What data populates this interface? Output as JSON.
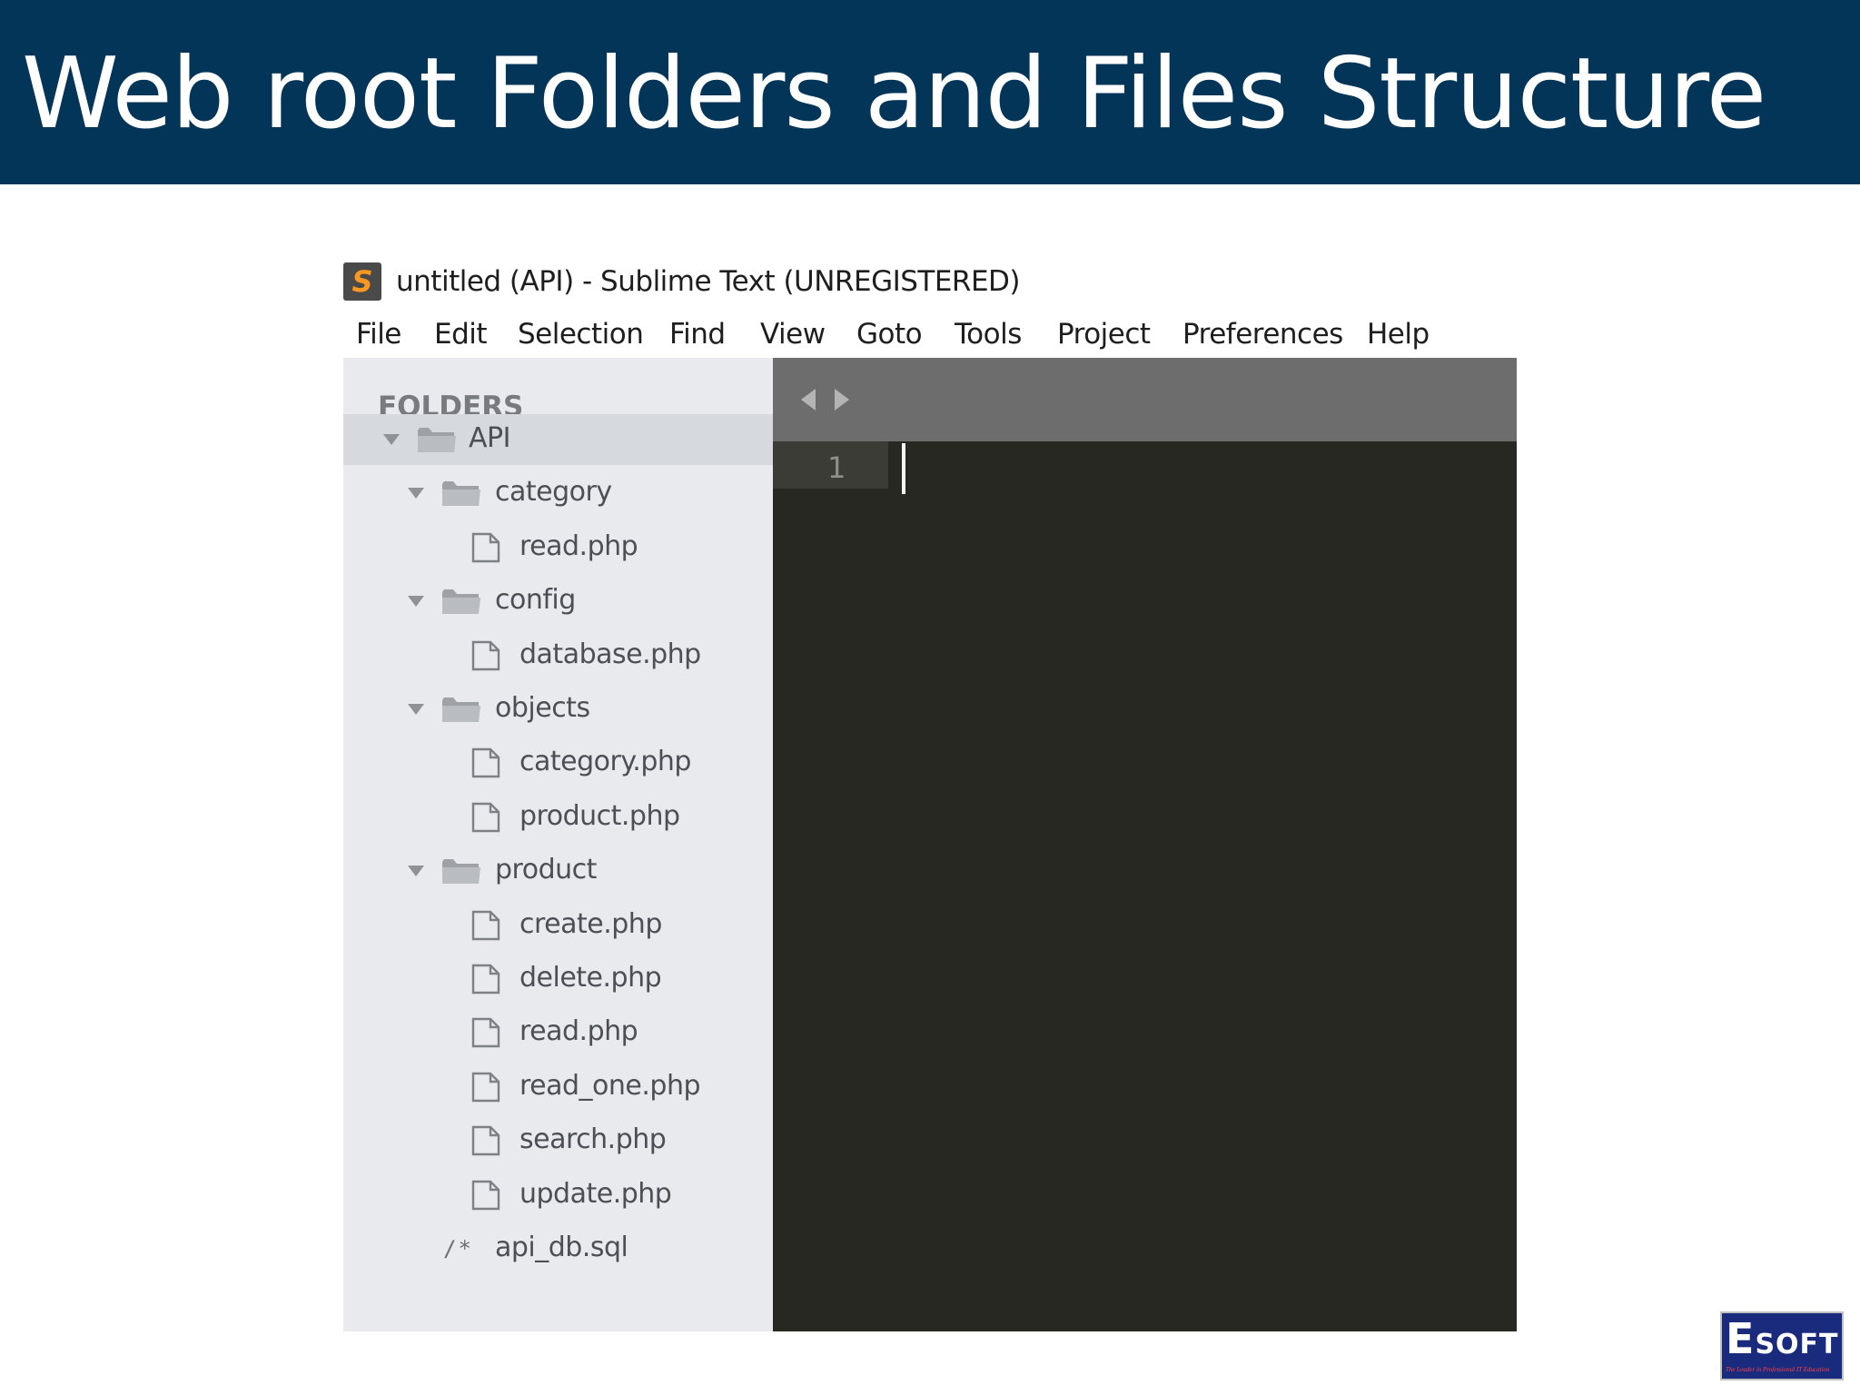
{
  "slide": {
    "title": "Web root Folders and Files Structure"
  },
  "window": {
    "app_icon_glyph": "S",
    "title": "untitled (API) - Sublime Text (UNREGISTERED)"
  },
  "menu": [
    "File",
    "Edit",
    "Selection",
    "Find",
    "View",
    "Goto",
    "Tools",
    "Project",
    "Preferences",
    "Help"
  ],
  "sidebar": {
    "heading": "FOLDERS",
    "tree": [
      {
        "type": "folder",
        "label": "API",
        "depth": 0,
        "expanded": true,
        "selected": true
      },
      {
        "type": "folder",
        "label": "category",
        "depth": 1,
        "expanded": true
      },
      {
        "type": "file",
        "label": "read.php",
        "depth": 2
      },
      {
        "type": "folder",
        "label": "config",
        "depth": 1,
        "expanded": true
      },
      {
        "type": "file",
        "label": "database.php",
        "depth": 2
      },
      {
        "type": "folder",
        "label": "objects",
        "depth": 1,
        "expanded": true
      },
      {
        "type": "file",
        "label": "category.php",
        "depth": 2
      },
      {
        "type": "file",
        "label": "product.php",
        "depth": 2
      },
      {
        "type": "folder",
        "label": "product",
        "depth": 1,
        "expanded": true
      },
      {
        "type": "file",
        "label": "create.php",
        "depth": 2
      },
      {
        "type": "file",
        "label": "delete.php",
        "depth": 2
      },
      {
        "type": "file",
        "label": "read.php",
        "depth": 2
      },
      {
        "type": "file",
        "label": "read_one.php",
        "depth": 2
      },
      {
        "type": "file",
        "label": "search.php",
        "depth": 2
      },
      {
        "type": "file",
        "label": "update.php",
        "depth": 2
      },
      {
        "type": "sql",
        "label": "api_db.sql",
        "depth": 1,
        "icon_text": "/*"
      }
    ]
  },
  "editor": {
    "line_number": "1",
    "theme_colors": {
      "background": "#272822",
      "tabbar": "#6d6d6d",
      "gutter_active": "#3b3c35"
    }
  },
  "logo": {
    "word_big": "E",
    "word_small": "SOFT",
    "tagline": "The Leader in Professional IT Education"
  },
  "colors": {
    "header_bg": "#023558",
    "sidebar_bg": "#e8eaed",
    "selection_bg": "#d6d9dd"
  }
}
